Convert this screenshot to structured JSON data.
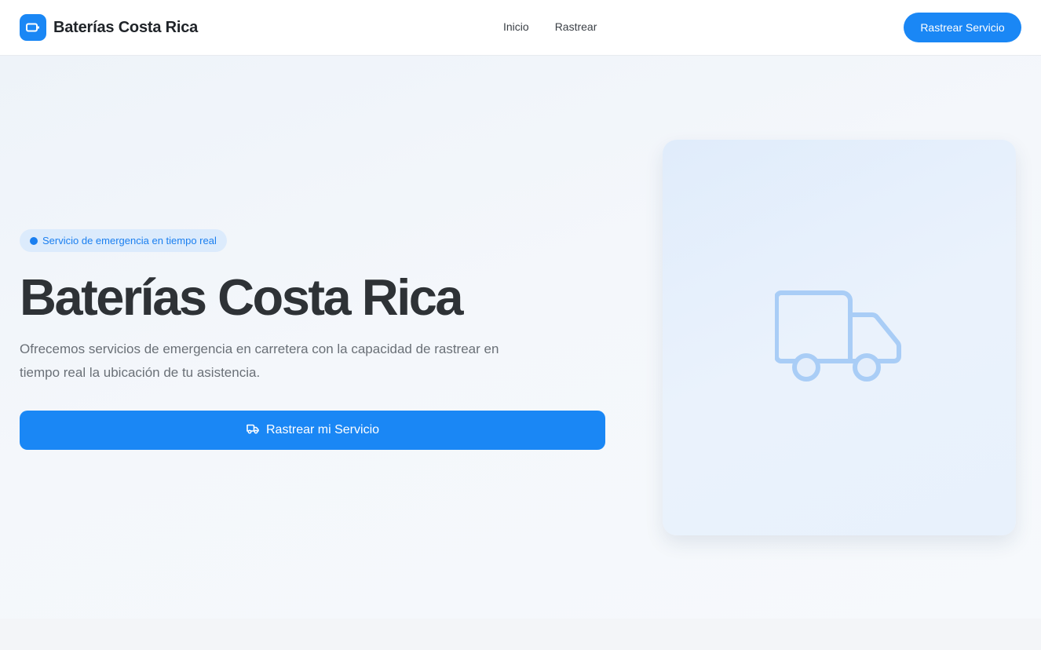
{
  "header": {
    "brand_name": "Baterías Costa Rica",
    "nav": [
      {
        "label": "Inicio"
      },
      {
        "label": "Rastrear"
      }
    ],
    "cta_label": "Rastrear Servicio"
  },
  "hero": {
    "badge": "Servicio de emergencia en tiempo real",
    "title": "Baterías Costa Rica",
    "description": "Ofrecemos servicios de emergencia en carretera con la capacidad de rastrear en tiempo real la ubicación de tu asistencia.",
    "cta_label": "Rastrear mi Servicio"
  },
  "icons": {
    "brand": "battery-icon",
    "cta": "truck-icon",
    "illustration": "truck-icon"
  },
  "colors": {
    "accent": "#1a87f5",
    "badge_bg": "#dcebfc",
    "title": "#2e3236",
    "text_muted": "#6a7077"
  }
}
